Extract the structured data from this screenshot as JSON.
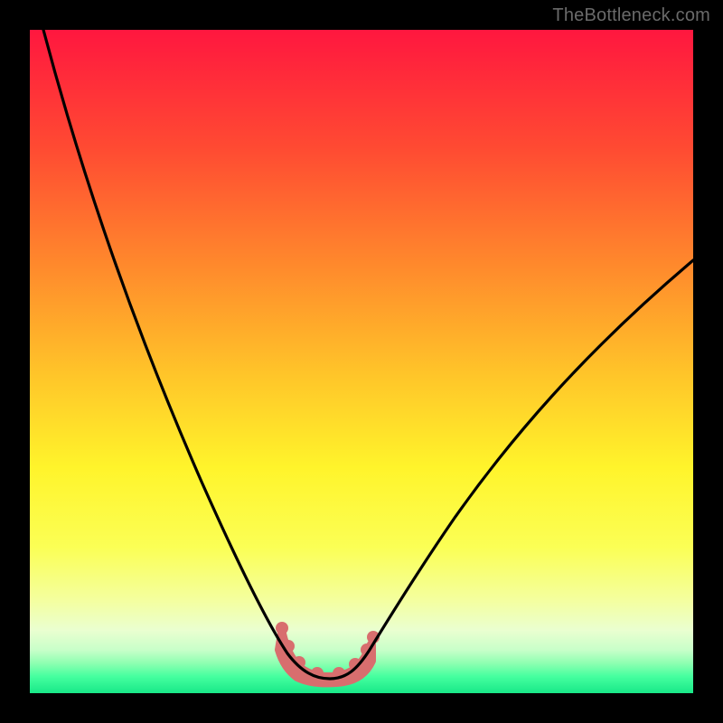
{
  "watermark": {
    "text": "TheBottleneck.com"
  },
  "chart_data": {
    "type": "line",
    "title": "",
    "xlabel": "",
    "ylabel": "",
    "xlim": [
      0,
      100
    ],
    "ylim": [
      0,
      100
    ],
    "grid": false,
    "legend": false,
    "background_gradient_stops": [
      {
        "offset": 0.0,
        "color": "#ff173f"
      },
      {
        "offset": 0.18,
        "color": "#ff4b32"
      },
      {
        "offset": 0.36,
        "color": "#ff8b2c"
      },
      {
        "offset": 0.52,
        "color": "#ffc529"
      },
      {
        "offset": 0.66,
        "color": "#fff42b"
      },
      {
        "offset": 0.78,
        "color": "#fbff55"
      },
      {
        "offset": 0.86,
        "color": "#f4ff9f"
      },
      {
        "offset": 0.905,
        "color": "#eaffd0"
      },
      {
        "offset": 0.935,
        "color": "#c8ffc9"
      },
      {
        "offset": 0.955,
        "color": "#8dffb1"
      },
      {
        "offset": 0.975,
        "color": "#45ff9f"
      },
      {
        "offset": 1.0,
        "color": "#18e888"
      }
    ],
    "series": [
      {
        "name": "bottleneck-curve",
        "color": "#000000",
        "x": [
          2,
          6,
          10,
          14,
          18,
          22,
          26,
          30,
          33,
          36,
          38.5,
          40.5,
          42,
          44,
          46,
          48,
          50.5,
          54,
          58,
          62,
          66,
          70,
          75,
          80,
          85,
          90,
          95,
          100
        ],
        "y": [
          100,
          88,
          76,
          65,
          55,
          46,
          38,
          30,
          23,
          17,
          12,
          8,
          5,
          3,
          2.4,
          3,
          5,
          9,
          14,
          19,
          24,
          29,
          35,
          40,
          45,
          50,
          55,
          60
        ]
      }
    ],
    "highlight_band": {
      "note": "pink marker/band at curve bottom",
      "color": "#d86e6e",
      "x_range": [
        38,
        51
      ],
      "y_range": [
        2,
        10
      ]
    }
  }
}
